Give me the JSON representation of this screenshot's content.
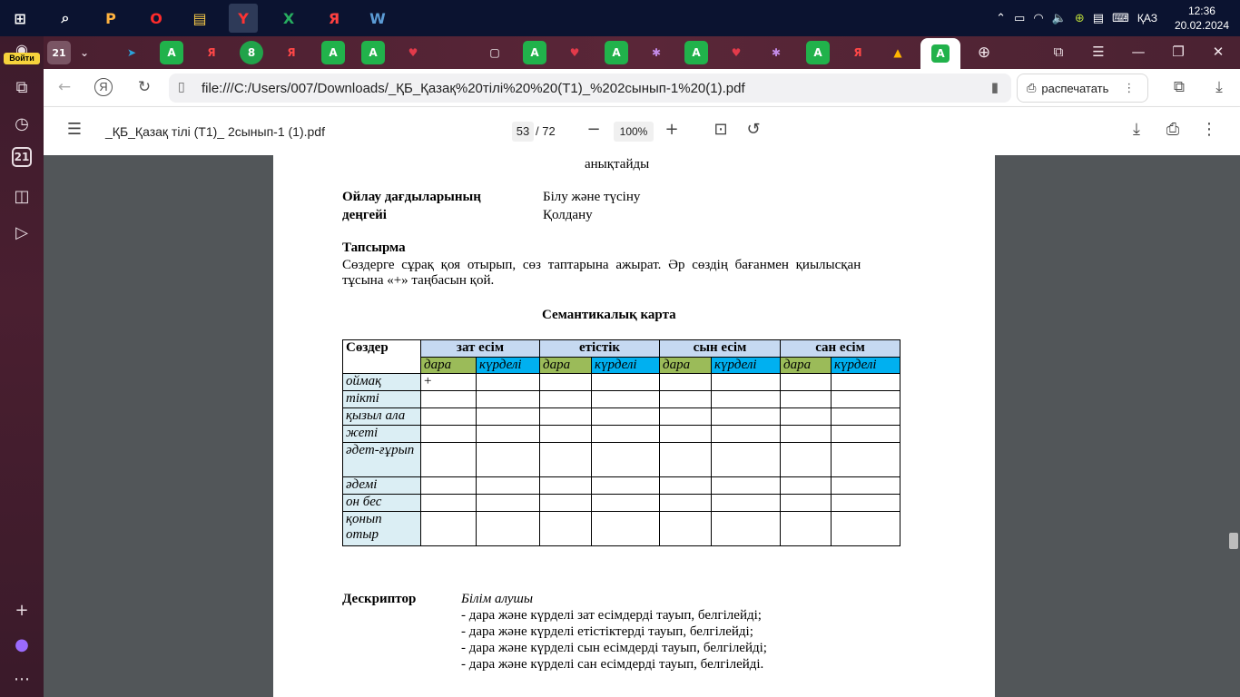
{
  "taskbar": {
    "apps": [
      "⊞",
      "⌕",
      "P",
      "O",
      "▤",
      "Y",
      "X",
      "Я",
      "W"
    ],
    "tray": {
      "language": "ҚАЗ",
      "time": "12:36",
      "date": "20.02.2024"
    }
  },
  "sidepanel": {
    "login_label": "Войти",
    "tab_count": "21",
    "calendar_day": "21"
  },
  "tabs": [
    {
      "icon": "21"
    },
    {
      "icon": "⌄"
    },
    {
      "icon": "➤"
    },
    {
      "icon": "A"
    },
    {
      "icon": "Я"
    },
    {
      "icon": "8"
    },
    {
      "icon": "Я"
    },
    {
      "icon": "A"
    },
    {
      "icon": "A"
    },
    {
      "icon": "♥"
    },
    {
      "icon": "▢"
    },
    {
      "icon": "A"
    },
    {
      "icon": "♥"
    },
    {
      "icon": "A"
    },
    {
      "icon": "✱"
    },
    {
      "icon": "A"
    },
    {
      "icon": "♥"
    },
    {
      "icon": "✱"
    },
    {
      "icon": "A"
    },
    {
      "icon": "Я"
    },
    {
      "icon": "▲"
    },
    {
      "icon": "A"
    }
  ],
  "address": {
    "url": "file:///C:/Users/007/Downloads/_ҚБ_Қазақ%20тілі%20%20(Т1)_%202сынып-1%20(1).pdf",
    "print_label": "распечатать"
  },
  "pdf": {
    "title": "_ҚБ_Қазақ тілі (Т1)_ 2сынып-1 (1).pdf",
    "page_current": "53",
    "page_total": "/ 72",
    "zoom": "100%"
  },
  "document": {
    "top_fragment": "анықтайды",
    "level_label_1": "Ойлау дағдыларының",
    "level_label_2": "деңгейі",
    "level_value_1": "Білу және түсіну",
    "level_value_2": "Қолдану",
    "task_heading": "Тапсырма",
    "task_line_1": "Сөздерге сұрақ қоя отырып, сөз таптарына ажырат. Әр сөздің бағанмен қиылысқан",
    "task_line_2": "тұсына «+» таңбасын қой.",
    "table_title": "Семантикалық карта",
    "table": {
      "first_header": "Сөздер",
      "groups": [
        "зат есім",
        "етістік",
        "сын есім",
        "сан есім"
      ],
      "sub_dara": "дара",
      "sub_kurdeli": "күрделі",
      "rows": [
        {
          "word": "оймақ",
          "mark": "+"
        },
        {
          "word": "тікті",
          "mark": ""
        },
        {
          "word": "қызыл ала",
          "mark": ""
        },
        {
          "word": "жеті",
          "mark": ""
        },
        {
          "word": "әдет-ғұрып",
          "mark": ""
        },
        {
          "word": "әдемі",
          "mark": ""
        },
        {
          "word": "он бес",
          "mark": ""
        },
        {
          "word": "қонып отыр",
          "mark": ""
        }
      ]
    },
    "descriptor_label": "Дескриптор",
    "descriptor_intro": "Білім алушы",
    "descriptor_items": [
      "- дара және күрделі зат есімдерді тауып, белгілейді;",
      "- дара және күрделі етістіктерді тауып, белгілейді;",
      "- дара және күрделі сын есімдерді тауып, белгілейді;",
      "- дара және күрделі  сан есімдерді тауып, белгілейді."
    ]
  }
}
